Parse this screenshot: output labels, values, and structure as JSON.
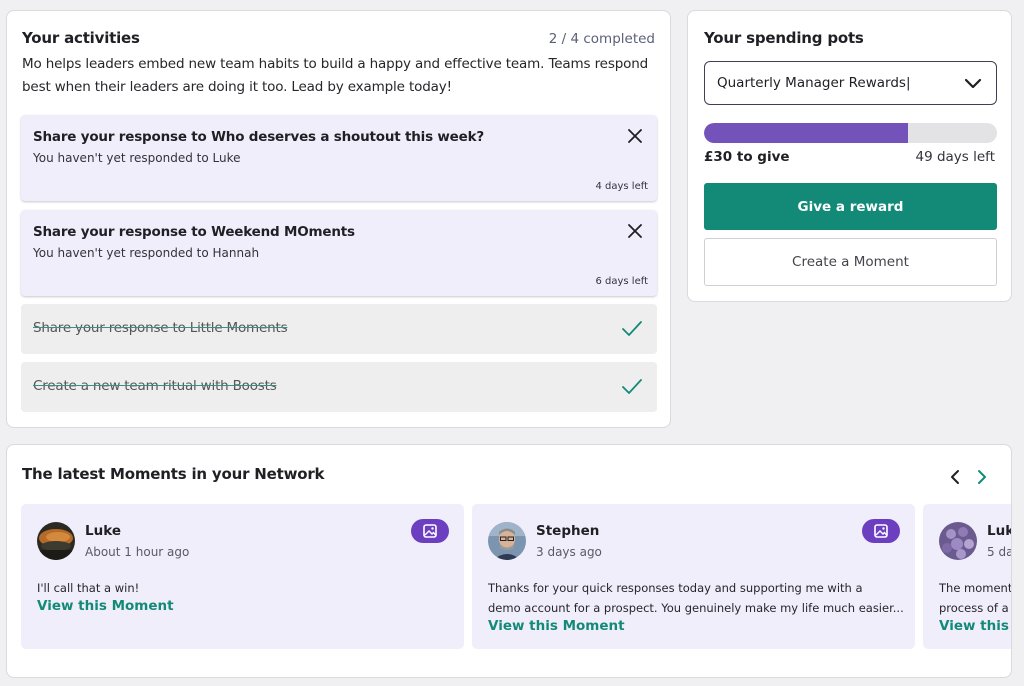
{
  "activities": {
    "title": "Your activities",
    "progress": "2 / 4 completed",
    "description": "Mo helps leaders embed new team habits to build a happy and effective team. Teams respond best when their leaders are doing it too. Lead by example today!",
    "open_tasks": [
      {
        "title": "Share your response to Who deserves a shoutout this week?",
        "subtitle": "You haven't yet responded to Luke",
        "due": "4 days left"
      },
      {
        "title": "Share your response to Weekend MOments",
        "subtitle": "You haven't yet responded to Hannah",
        "due": "6 days left"
      }
    ],
    "done_tasks": [
      {
        "title": "Share your response to Little Moments"
      },
      {
        "title": "Create a new team ritual with Boosts"
      }
    ]
  },
  "pots": {
    "title": "Your spending pots",
    "selected_pot": "Quarterly Manager Rewards|",
    "progress_fraction": 0.697,
    "to_give": "£30 to give",
    "days_left": "49 days left",
    "give_reward_label": "Give a reward",
    "create_moment_label": "Create a Moment"
  },
  "network": {
    "title": "The latest Moments in your Network",
    "moments": [
      {
        "name": "Luke",
        "time": "About 1 hour ago",
        "lines": [
          "I'll call that a win!"
        ],
        "link": "View this Moment"
      },
      {
        "name": "Stephen",
        "time": "3 days ago",
        "lines": [
          "Thanks for your quick responses today and supporting me with a",
          "demo account for a prospect. You genuinely make my life much easier..."
        ],
        "link": "View this Moment"
      },
      {
        "name": "Luk",
        "time": "5 da",
        "lines": [
          "The moment",
          "process of a"
        ],
        "link": "View this"
      }
    ]
  },
  "colors": {
    "accent_teal": "#138a78",
    "pot_purple": "#7353b9",
    "badge_purple": "#6c3fc0",
    "task_bg": "#f1eefb"
  },
  "icons": [
    "close-icon",
    "check-icon",
    "chevron-down-icon",
    "image-icon",
    "chevron-left-icon",
    "chevron-right-icon"
  ]
}
